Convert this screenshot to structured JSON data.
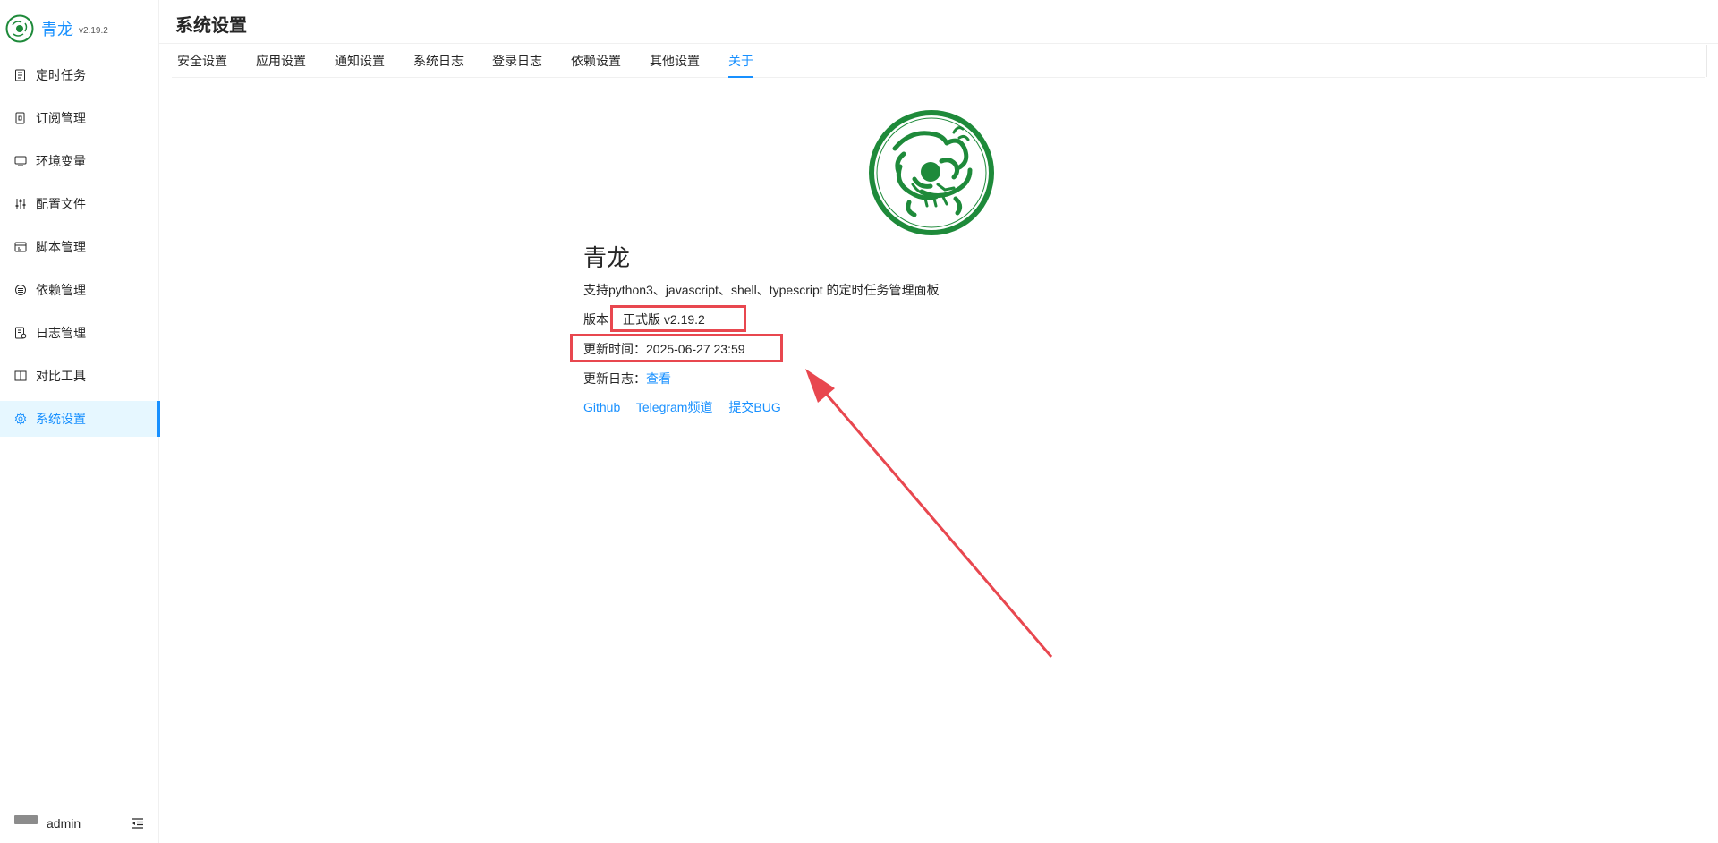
{
  "app": {
    "name": "青龙",
    "version": "v2.19.2"
  },
  "sidebar": {
    "items": [
      {
        "label": "定时任务",
        "icon": "task-list-icon"
      },
      {
        "label": "订阅管理",
        "icon": "subscription-icon"
      },
      {
        "label": "环境变量",
        "icon": "monitor-icon"
      },
      {
        "label": "配置文件",
        "icon": "sliders-icon"
      },
      {
        "label": "脚本管理",
        "icon": "script-icon"
      },
      {
        "label": "依赖管理",
        "icon": "package-icon"
      },
      {
        "label": "日志管理",
        "icon": "log-icon"
      },
      {
        "label": "对比工具",
        "icon": "diff-icon"
      },
      {
        "label": "系统设置",
        "icon": "gear-icon",
        "active": true
      }
    ],
    "user": "admin"
  },
  "page": {
    "title": "系统设置"
  },
  "tabs": [
    {
      "label": "安全设置"
    },
    {
      "label": "应用设置"
    },
    {
      "label": "通知设置"
    },
    {
      "label": "系统日志"
    },
    {
      "label": "登录日志"
    },
    {
      "label": "依赖设置"
    },
    {
      "label": "其他设置"
    },
    {
      "label": "关于",
      "active": true
    }
  ],
  "about": {
    "title": "青龙",
    "description": "支持python3、javascript、shell、typescript 的定时任务管理面板",
    "version_label": "版本：",
    "version_value": "正式版 v2.19.2",
    "updated_label": "更新时间：",
    "updated_value": "2025-06-27 23:59",
    "changelog_label": "更新日志：",
    "changelog_link": "查看",
    "links": [
      "Github",
      "Telegram频道",
      "提交BUG"
    ]
  },
  "colors": {
    "accent": "#1890ff",
    "highlight": "#e8474f",
    "logo_green": "#1e8a3a"
  }
}
